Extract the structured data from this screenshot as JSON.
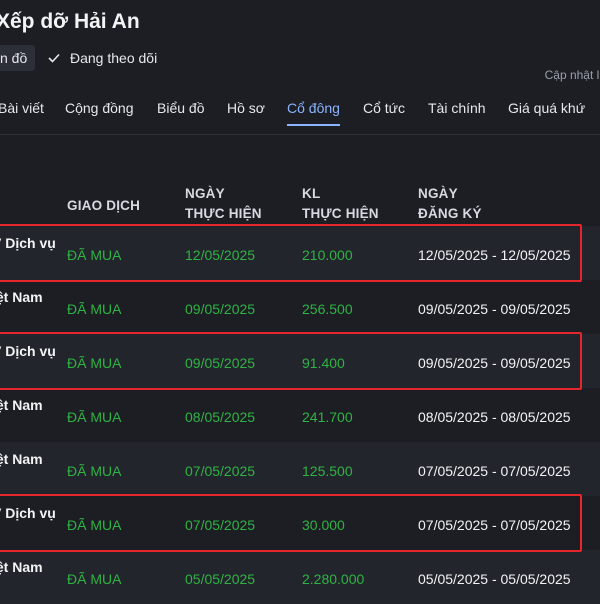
{
  "header": {
    "title": "Xếp dỡ Hải An",
    "map_chip": "n đồ",
    "follow_label": "Đang theo dõi",
    "updated_text": "Cập nhật lú"
  },
  "tabs": [
    {
      "label": "Bài viết"
    },
    {
      "label": "Cộng đồng"
    },
    {
      "label": "Biểu đồ"
    },
    {
      "label": "Hồ sơ"
    },
    {
      "label": "Cổ đông",
      "active": true
    },
    {
      "label": "Cổ tức"
    },
    {
      "label": "Tài chính"
    },
    {
      "label": "Giá quá khứ"
    }
  ],
  "columns": {
    "type": "GIAO DỊCH",
    "date_l1": "NGÀY",
    "date_l2": "THỰC HIỆN",
    "vol_l1": "KL",
    "vol_l2": "THỰC HIỆN",
    "reg_l1": "NGÀY",
    "reg_l2": "ĐĂNG KÝ"
  },
  "rows": [
    {
      "name": "V Dịch vụ",
      "type": "ĐÃ MUA",
      "date": "12/05/2025",
      "volume": "210.000",
      "registration": "12/05/2025 - 12/05/2025",
      "highlighted": true
    },
    {
      "name": "iệt Nam",
      "type": "ĐÃ MUA",
      "date": "09/05/2025",
      "volume": "256.500",
      "registration": "09/05/2025 - 09/05/2025",
      "highlighted": false
    },
    {
      "name": "V Dịch vụ",
      "type": "ĐÃ MUA",
      "date": "09/05/2025",
      "volume": "91.400",
      "registration": "09/05/2025 - 09/05/2025",
      "highlighted": true
    },
    {
      "name": "iệt Nam",
      "type": "ĐÃ MUA",
      "date": "08/05/2025",
      "volume": "241.700",
      "registration": "08/05/2025 - 08/05/2025",
      "highlighted": false
    },
    {
      "name": "iệt Nam",
      "type": "ĐÃ MUA",
      "date": "07/05/2025",
      "volume": "125.500",
      "registration": "07/05/2025 - 07/05/2025",
      "highlighted": false
    },
    {
      "name": "V Dịch vụ",
      "type": "ĐÃ MUA",
      "date": "07/05/2025",
      "volume": "30.000",
      "registration": "07/05/2025 - 07/05/2025",
      "highlighted": true
    },
    {
      "name": "iệt Nam",
      "type": "ĐÃ MUA",
      "date": "05/05/2025",
      "volume": "2.280.000",
      "registration": "05/05/2025 - 05/05/2025",
      "highlighted": false
    }
  ],
  "colors": {
    "buy_green": "#2fb344",
    "highlight_red": "#e5262c",
    "active_tab": "#8ab4ff"
  }
}
